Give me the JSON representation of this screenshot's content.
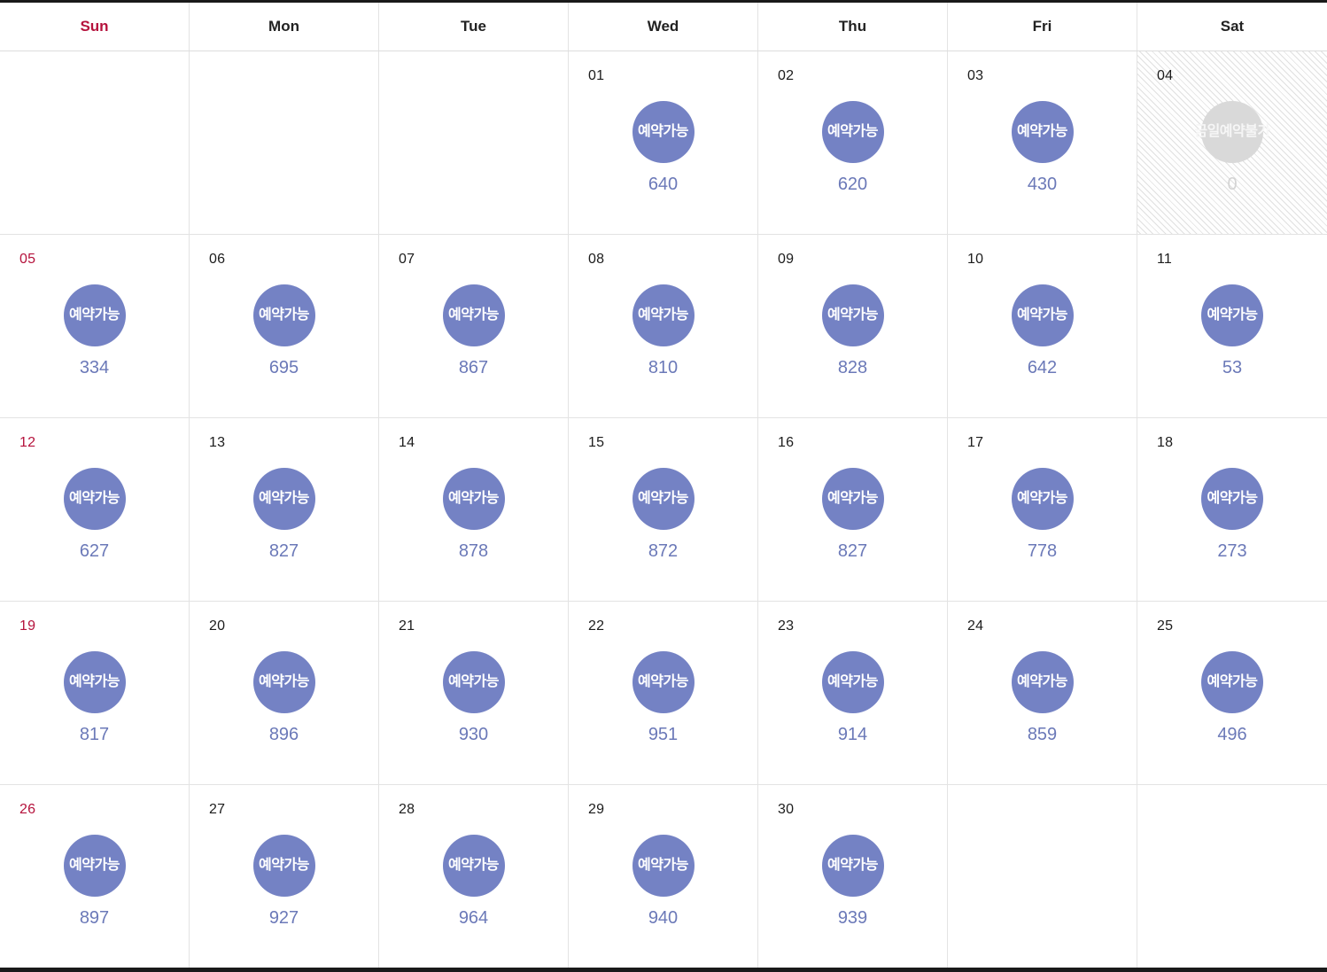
{
  "calendar": {
    "weekday_headers": [
      {
        "label": "Sun",
        "sunday": true
      },
      {
        "label": "Mon",
        "sunday": false
      },
      {
        "label": "Tue",
        "sunday": false
      },
      {
        "label": "Wed",
        "sunday": false
      },
      {
        "label": "Thu",
        "sunday": false
      },
      {
        "label": "Fri",
        "sunday": false
      },
      {
        "label": "Sat",
        "sunday": false
      }
    ],
    "status_labels": {
      "available": "예약가능",
      "unavailable": "금일예약불가"
    },
    "colors": {
      "available_circle": "#7482c4",
      "unavailable_circle": "#d9d9d9",
      "count_text": "#6b79b8",
      "count_text_disabled": "#d4d4d4",
      "sunday_text": "#b5123c",
      "grid_border": "#e3e3e3",
      "outer_border": "#1a1a1a"
    },
    "weeks": [
      [
        {
          "type": "empty"
        },
        {
          "type": "empty"
        },
        {
          "type": "empty"
        },
        {
          "type": "day",
          "day": "01",
          "status": "available",
          "status_label": "예약가능",
          "count": "640",
          "sunday": false
        },
        {
          "type": "day",
          "day": "02",
          "status": "available",
          "status_label": "예약가능",
          "count": "620",
          "sunday": false
        },
        {
          "type": "day",
          "day": "03",
          "status": "available",
          "status_label": "예약가능",
          "count": "430",
          "sunday": false
        },
        {
          "type": "day",
          "day": "04",
          "status": "unavailable",
          "status_label": "금일예약불가",
          "count": "0",
          "sunday": false
        }
      ],
      [
        {
          "type": "day",
          "day": "05",
          "status": "available",
          "status_label": "예약가능",
          "count": "334",
          "sunday": true
        },
        {
          "type": "day",
          "day": "06",
          "status": "available",
          "status_label": "예약가능",
          "count": "695",
          "sunday": false
        },
        {
          "type": "day",
          "day": "07",
          "status": "available",
          "status_label": "예약가능",
          "count": "867",
          "sunday": false
        },
        {
          "type": "day",
          "day": "08",
          "status": "available",
          "status_label": "예약가능",
          "count": "810",
          "sunday": false
        },
        {
          "type": "day",
          "day": "09",
          "status": "available",
          "status_label": "예약가능",
          "count": "828",
          "sunday": false
        },
        {
          "type": "day",
          "day": "10",
          "status": "available",
          "status_label": "예약가능",
          "count": "642",
          "sunday": false
        },
        {
          "type": "day",
          "day": "11",
          "status": "available",
          "status_label": "예약가능",
          "count": "53",
          "sunday": false
        }
      ],
      [
        {
          "type": "day",
          "day": "12",
          "status": "available",
          "status_label": "예약가능",
          "count": "627",
          "sunday": true
        },
        {
          "type": "day",
          "day": "13",
          "status": "available",
          "status_label": "예약가능",
          "count": "827",
          "sunday": false
        },
        {
          "type": "day",
          "day": "14",
          "status": "available",
          "status_label": "예약가능",
          "count": "878",
          "sunday": false
        },
        {
          "type": "day",
          "day": "15",
          "status": "available",
          "status_label": "예약가능",
          "count": "872",
          "sunday": false
        },
        {
          "type": "day",
          "day": "16",
          "status": "available",
          "status_label": "예약가능",
          "count": "827",
          "sunday": false
        },
        {
          "type": "day",
          "day": "17",
          "status": "available",
          "status_label": "예약가능",
          "count": "778",
          "sunday": false
        },
        {
          "type": "day",
          "day": "18",
          "status": "available",
          "status_label": "예약가능",
          "count": "273",
          "sunday": false
        }
      ],
      [
        {
          "type": "day",
          "day": "19",
          "status": "available",
          "status_label": "예약가능",
          "count": "817",
          "sunday": true
        },
        {
          "type": "day",
          "day": "20",
          "status": "available",
          "status_label": "예약가능",
          "count": "896",
          "sunday": false
        },
        {
          "type": "day",
          "day": "21",
          "status": "available",
          "status_label": "예약가능",
          "count": "930",
          "sunday": false
        },
        {
          "type": "day",
          "day": "22",
          "status": "available",
          "status_label": "예약가능",
          "count": "951",
          "sunday": false
        },
        {
          "type": "day",
          "day": "23",
          "status": "available",
          "status_label": "예약가능",
          "count": "914",
          "sunday": false
        },
        {
          "type": "day",
          "day": "24",
          "status": "available",
          "status_label": "예약가능",
          "count": "859",
          "sunday": false
        },
        {
          "type": "day",
          "day": "25",
          "status": "available",
          "status_label": "예약가능",
          "count": "496",
          "sunday": false
        }
      ],
      [
        {
          "type": "day",
          "day": "26",
          "status": "available",
          "status_label": "예약가능",
          "count": "897",
          "sunday": true
        },
        {
          "type": "day",
          "day": "27",
          "status": "available",
          "status_label": "예약가능",
          "count": "927",
          "sunday": false
        },
        {
          "type": "day",
          "day": "28",
          "status": "available",
          "status_label": "예약가능",
          "count": "964",
          "sunday": false
        },
        {
          "type": "day",
          "day": "29",
          "status": "available",
          "status_label": "예약가능",
          "count": "940",
          "sunday": false
        },
        {
          "type": "day",
          "day": "30",
          "status": "available",
          "status_label": "예약가능",
          "count": "939",
          "sunday": false
        },
        {
          "type": "empty"
        },
        {
          "type": "empty"
        }
      ]
    ]
  }
}
